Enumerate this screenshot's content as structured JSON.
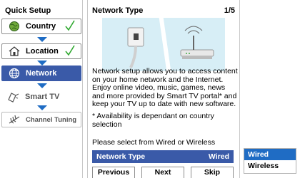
{
  "sidebar": {
    "title": "Quick Setup",
    "steps": [
      {
        "label": "Country",
        "icon": "globe-icon",
        "done": true
      },
      {
        "label": "Location",
        "icon": "house-icon",
        "done": true
      },
      {
        "label": "Network",
        "icon": "network-globe-icon",
        "active": true
      },
      {
        "label": "Smart TV",
        "icon": "tv-icon"
      },
      {
        "label": "Channel Tuning",
        "icon": "antenna-icon"
      }
    ]
  },
  "panel": {
    "title": "Network Type",
    "page": "1/5",
    "description": "Network setup allows you to access content on your home network and the Internet. Enjoy online video, music, games, news and more provided by Smart TV portal* and keep your TV up to date with new software.",
    "note": "* Availability is dependant on country selection",
    "prompt": "Please select from Wired or Wireless",
    "selector": {
      "label": "Network Type",
      "value": "Wired"
    },
    "buttons": {
      "previous": "Previous",
      "next": "Next",
      "skip": "Skip"
    }
  },
  "dropdown": {
    "options": [
      "Wired",
      "Wireless"
    ],
    "selected": "Wired"
  },
  "colors": {
    "accent": "#3a5aa8",
    "highlight": "#1f6cc4",
    "check": "#2fa82f"
  }
}
